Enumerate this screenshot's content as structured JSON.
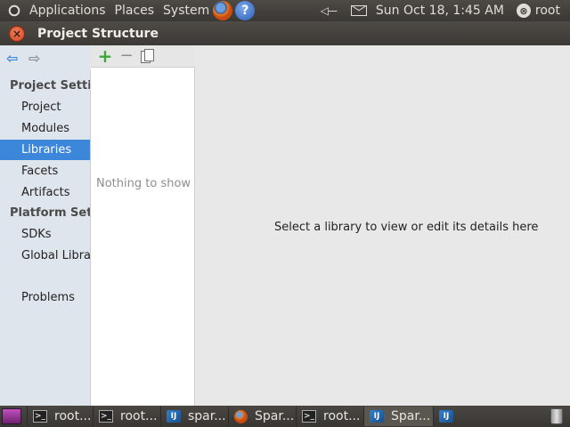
{
  "top_panel": {
    "menus": [
      "Applications",
      "Places",
      "System"
    ],
    "help_glyph": "?",
    "volume_glyph": "◁---",
    "clock": "Sun Oct 18,  1:45 AM",
    "user": "root",
    "user_glyph": "⊗",
    "icons": [
      "ubuntu-logo-icon",
      "firefox-icon",
      "help-icon",
      "volume-icon",
      "mail-icon",
      "user-switch-icon"
    ]
  },
  "window": {
    "title": "Project Structure",
    "close_glyph": "×"
  },
  "nav": {
    "back_glyph": "⇦",
    "forward_glyph": "⇨"
  },
  "sidebar": {
    "project_settings_heading": "Project Settings",
    "project_items": [
      "Project",
      "Modules",
      "Libraries",
      "Facets",
      "Artifacts"
    ],
    "platform_settings_heading": "Platform Settings",
    "platform_items": [
      "SDKs",
      "Global Libraries"
    ],
    "problems": "Problems",
    "selected": "Libraries",
    "selected_color": "#3c87d9"
  },
  "list_toolbar": {
    "add_glyph": "+",
    "remove_glyph": "−"
  },
  "list_panel": {
    "empty_text": "Nothing to show"
  },
  "detail_panel": {
    "hint": "Select a library to view or edit its details here"
  },
  "taskbar": {
    "tasks": [
      {
        "label": "root...",
        "icon": "terminal-icon",
        "glyph": ">_"
      },
      {
        "label": "root...",
        "icon": "terminal-icon",
        "glyph": ">_"
      },
      {
        "label": "spar...",
        "icon": "intellij-icon",
        "glyph": "IJ"
      },
      {
        "label": "Spar...",
        "icon": "firefox-icon",
        "glyph": ""
      },
      {
        "label": "root...",
        "icon": "terminal-icon",
        "glyph": ">_"
      },
      {
        "label": "Spar...",
        "icon": "intellij-icon",
        "glyph": "IJ",
        "active": true
      },
      {
        "label": "",
        "icon": "intellij-icon",
        "glyph": "IJ"
      }
    ]
  }
}
